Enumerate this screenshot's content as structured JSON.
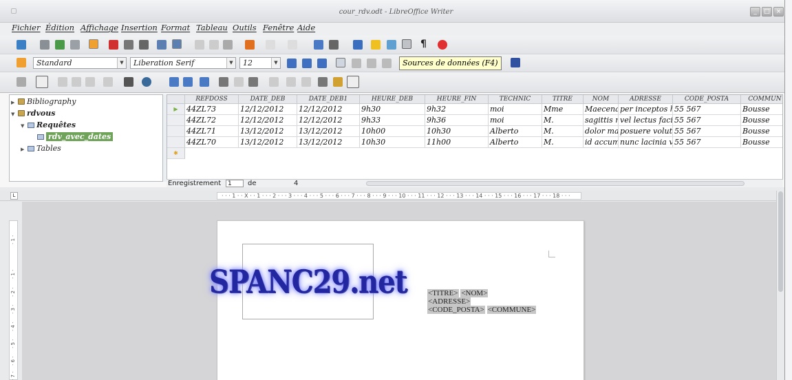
{
  "window": {
    "title": "cour_rdv.odt - LibreOffice Writer",
    "buttons": [
      "_",
      "□",
      "×"
    ]
  },
  "menu": [
    {
      "label": "Fichier"
    },
    {
      "label": "Édition"
    },
    {
      "label": "Affichage"
    },
    {
      "label": "Insertion"
    },
    {
      "label": "Format"
    },
    {
      "label": "Tableau"
    },
    {
      "label": "Outils"
    },
    {
      "label": "Fenêtre"
    },
    {
      "label": "Aide"
    }
  ],
  "format_bar": {
    "paragraph_style": "Standard",
    "font_name": "Liberation Serif",
    "font_size": "12"
  },
  "tooltip": "Sources de données (F4)",
  "datasource_tree": [
    {
      "label": "Bibliography",
      "expanded": false
    },
    {
      "label": "rdvous",
      "expanded": true
    },
    {
      "label": "Requêtes",
      "expanded": true
    },
    {
      "label": "rdv_avec_dates",
      "selected": true
    },
    {
      "label": "Tables",
      "expanded": false
    }
  ],
  "grid": {
    "columns": [
      "REFDOSS",
      "DATE_DEB",
      "DATE_DEB1",
      "HEURE_DEB",
      "HEURE_FIN",
      "TECHNIC",
      "TITRE",
      "NOM",
      "ADRESSE",
      "CODE_POSTA",
      "COMMUN"
    ],
    "rows": [
      [
        "44ZL73",
        "12/12/2012",
        "12/12/2012",
        "9h30",
        "9h32",
        "moi",
        "Mme",
        "Maecenas",
        "per inceptos hin",
        "55 567",
        "Bousse"
      ],
      [
        "44ZL72",
        "12/12/2012",
        "12/12/2012",
        "9h33",
        "9h36",
        "moi",
        "M.",
        "sagittis m",
        "vel lectus facilis",
        "55 567",
        "Bousse"
      ],
      [
        "44ZL71",
        "13/12/2012",
        "13/12/2012",
        "10h00",
        "10h30",
        "Alberto",
        "M.",
        "dolor mas",
        "posuere volutpa",
        "55 567",
        "Bousse"
      ],
      [
        "44ZL70",
        "13/12/2012",
        "13/12/2012",
        "10h30",
        "11h00",
        "Alberto",
        "M.",
        "id accums",
        "nunc lacinia vel",
        "55 567",
        "Bousse"
      ]
    ],
    "current_row_marker": "▶",
    "new_row_marker": "✱"
  },
  "record_nav": {
    "label": "Enregistrement",
    "current": "1",
    "of_label": "de",
    "total": "4"
  },
  "ruler": {
    "text": "· · · 1 · · X · · 1 · · · 2 · · · 3 · · · 4 · · · 5 · · · 6 · · · 7 · · · 8 · · · 9 · · · 10 · · · 11 · · · 12 · · · 13 · · · 14 · · · 15 · · · 16 · · · 17 · · · 18 · · ·"
  },
  "vruler_marks": [
    "· 1 ·",
    "· 1 ·",
    "· 2 ·",
    "· 3 ·",
    "· 4 ·",
    "· 5 ·",
    "· 6 ·",
    "· 7 ·"
  ],
  "document": {
    "logo_text": "SPANC29.net",
    "fields": {
      "titre": "<TITRE>",
      "nom": "<NOM>",
      "adresse": "<ADRESSE>",
      "code_posta": "<CODE_POSTA>",
      "commune": "<COMMUNE>"
    }
  },
  "colors": {
    "selection": "#6fa35a",
    "tooltip_bg": "#ffffcc",
    "field_bg": "#c6c6c6"
  }
}
